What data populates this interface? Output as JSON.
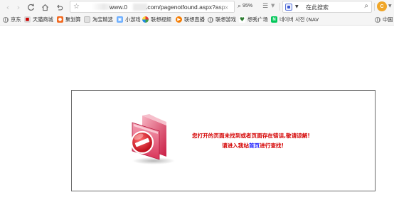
{
  "colors": {
    "toolbar_bg": "#f5f5f5",
    "error_text": "#d40000",
    "link": "#1a1aff",
    "box_border": "#6b6b6b"
  },
  "toolbar": {
    "back_icon": "back-arrow-icon",
    "forward_icon": "forward-arrow-icon",
    "reload_icon": "reload-icon",
    "home_icon": "home-icon",
    "undo_icon": "undo-icon",
    "address": {
      "prefix": "www.0",
      "rest": ".com/pagenotfound.aspx?aspx"
    },
    "zoom": "95%",
    "search": {
      "placeholder": "在此搜索"
    },
    "extension_label": "C"
  },
  "bookmarks": [
    {
      "label": "京东",
      "icon": "globe-icon"
    },
    {
      "label": "天猫商城",
      "icon": "tmall-icon"
    },
    {
      "label": "聚划算",
      "icon": "juhuasuan-icon"
    },
    {
      "label": "淘宝精选",
      "icon": "taobao-icon"
    },
    {
      "label": "小游戏",
      "icon": "game-icon"
    },
    {
      "label": "联想视频",
      "icon": "video-icon"
    },
    {
      "label": "联想直播",
      "icon": "live-icon"
    },
    {
      "label": "联想游戏",
      "icon": "globe-icon"
    },
    {
      "label": "想秀广场",
      "icon": "xiangxiu-icon"
    },
    {
      "label": "네이버 사전 (NAV",
      "icon": "naver-icon"
    },
    {
      "label": "中国",
      "icon": "globe-icon"
    }
  ],
  "error": {
    "line1": "您打开的页面未找到或者页面存在错误,敬请谅解!",
    "line2_before": "请进入我站",
    "line2_link": "首页",
    "line2_after": "进行查找!"
  }
}
